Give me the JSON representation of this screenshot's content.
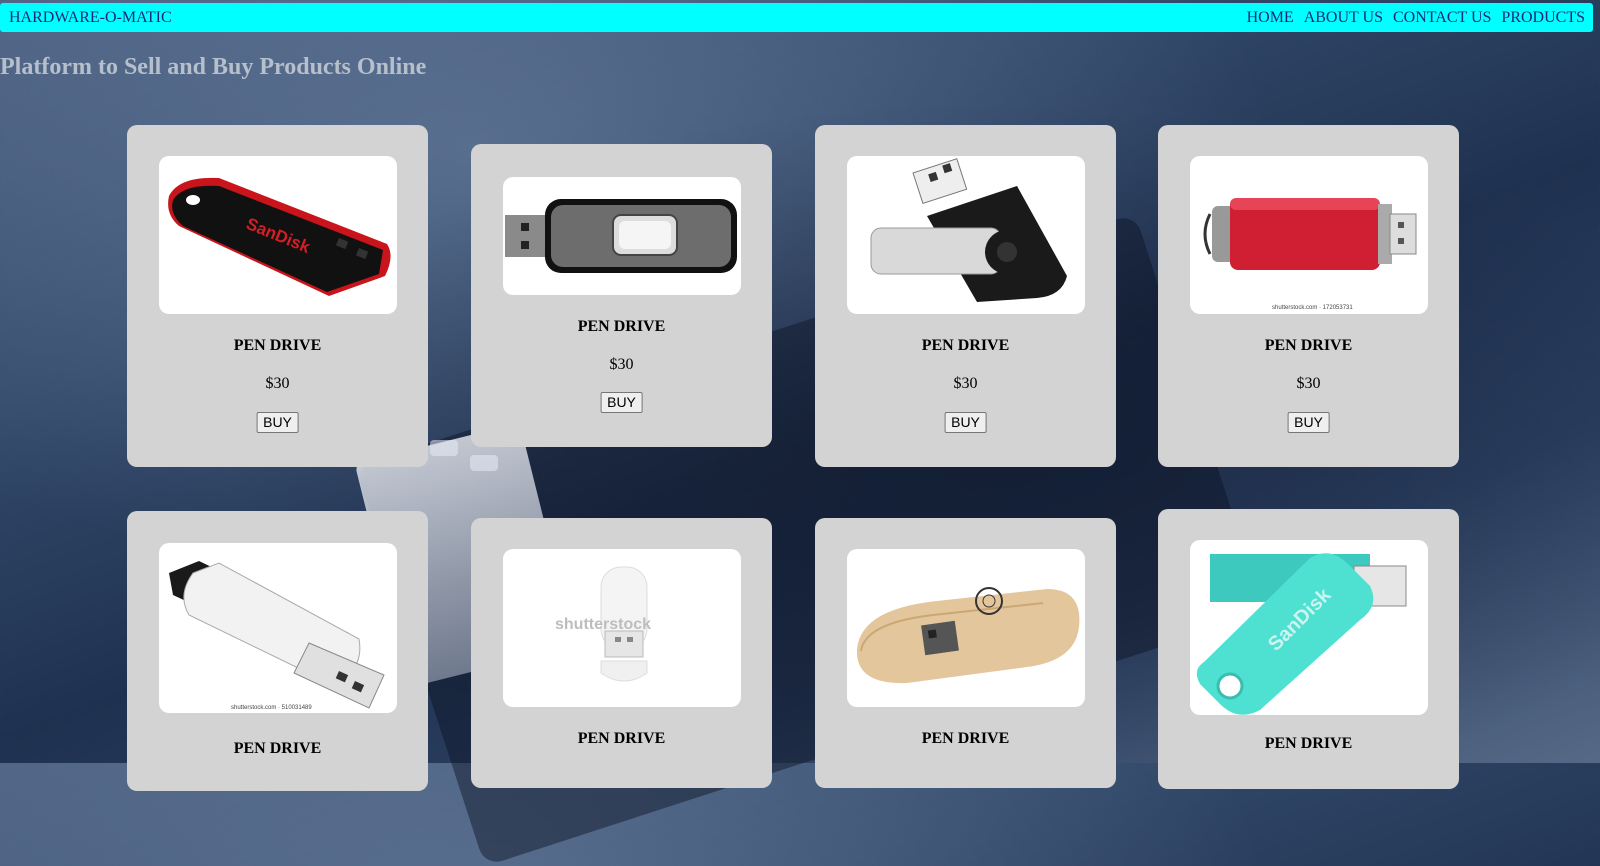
{
  "navbar": {
    "brand": "HARDWARE-O-MATIC",
    "links": [
      "HOME",
      "ABOUT US",
      "CONTACT US",
      "PRODUCTS"
    ]
  },
  "tagline": "Platform to Sell and Buy Products Online",
  "products": [
    {
      "title": "PEN DRIVE",
      "price": "$30",
      "button": "BUY",
      "image_brand": "SanDisk"
    },
    {
      "title": "PEN DRIVE",
      "price": "$30",
      "button": "BUY"
    },
    {
      "title": "PEN DRIVE",
      "price": "$30",
      "button": "BUY"
    },
    {
      "title": "PEN DRIVE",
      "price": "$30",
      "button": "BUY",
      "image_watermark": "shutterstock.com · 172053731"
    },
    {
      "title": "PEN DRIVE",
      "image_watermark": "shutterstock.com · 510031489"
    },
    {
      "title": "PEN DRIVE",
      "image_watermark": "shutterstock"
    },
    {
      "title": "PEN DRIVE"
    },
    {
      "title": "PEN DRIVE",
      "image_brand": "SanDisk"
    }
  ],
  "colors": {
    "navbar": "#00ffff",
    "card": "#d3d3d3",
    "nav_text": "#1a2a7a",
    "tagline": "#b6bfcc"
  }
}
